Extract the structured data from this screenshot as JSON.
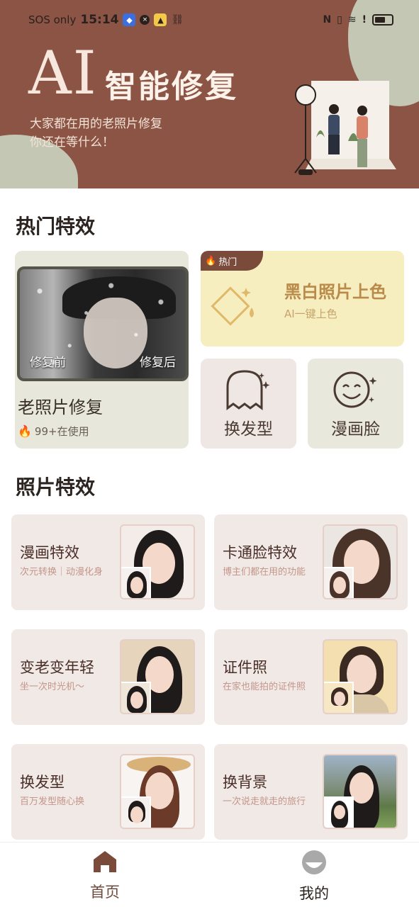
{
  "status_bar": {
    "carrier": "SOS only",
    "time": "15:14"
  },
  "header": {
    "title_ai": "AI",
    "title_zh": "智能修复",
    "subtitle_line1": "大家都在用的老照片修复",
    "subtitle_line2": "你还在等什么！"
  },
  "hot_section": {
    "title": "热门特效",
    "old_photo": {
      "before_label": "修复前",
      "after_label": "修复后",
      "title": "老照片修复",
      "usage": "99+在使用"
    },
    "colorize": {
      "tag": "热门",
      "title": "黑白照片上色",
      "subtitle": "AI一键上色"
    },
    "hairstyle": {
      "label": "换发型"
    },
    "cartoon_face": {
      "label": "漫画脸"
    }
  },
  "photo_section": {
    "title": "照片特效",
    "items": [
      {
        "title": "漫画特效",
        "subtitle": "次元转换｜动漫化身"
      },
      {
        "title": "卡通脸特效",
        "subtitle": "博主们都在用的功能"
      },
      {
        "title": "变老变年轻",
        "subtitle": "坐一次时光机～"
      },
      {
        "title": "证件照",
        "subtitle": "在家也能拍的证件照"
      },
      {
        "title": "换发型",
        "subtitle": "百万发型随心换"
      },
      {
        "title": "换背景",
        "subtitle": "一次说走就走的旅行"
      }
    ]
  },
  "nav": {
    "home": "首页",
    "mine": "我的"
  },
  "colors": {
    "header_bg": "#8b5444",
    "accent_brown": "#7a4a3a",
    "card_bg": "#f0e9e6",
    "colorize_bg": "#f7eebf"
  }
}
